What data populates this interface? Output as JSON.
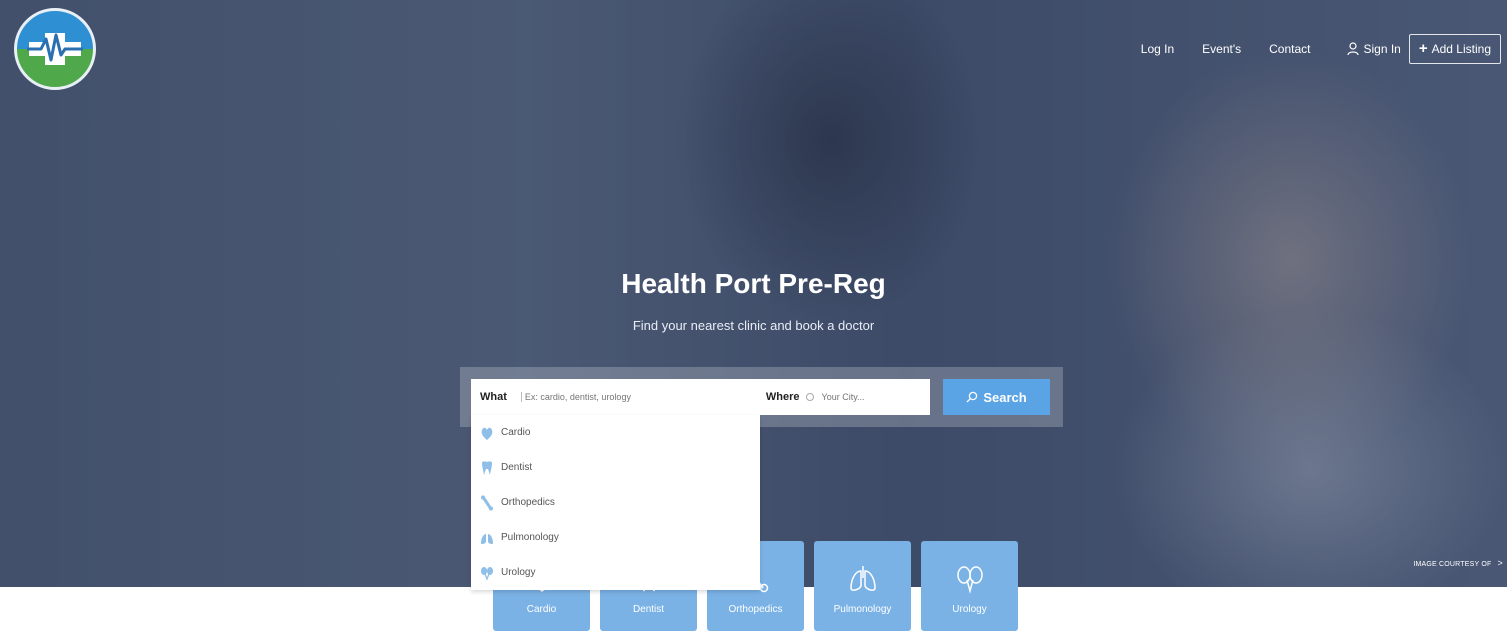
{
  "nav": {
    "login": "Log In",
    "events": "Event's",
    "contact": "Contact",
    "signin": "Sign In",
    "add_listing": "Add Listing"
  },
  "hero": {
    "title": "Health Port Pre-Reg",
    "subtitle": "Find your nearest clinic and book a doctor"
  },
  "search": {
    "what_label": "What",
    "what_placeholder": "Ex: cardio, dentist, urology",
    "where_label": "Where",
    "where_placeholder": "Your City...",
    "button_label": "Search"
  },
  "dropdown": {
    "items": [
      {
        "label": "Cardio",
        "icon": "heart-icon"
      },
      {
        "label": "Dentist",
        "icon": "tooth-icon"
      },
      {
        "label": "Orthopedics",
        "icon": "bone-icon"
      },
      {
        "label": "Pulmonology",
        "icon": "lungs-icon"
      },
      {
        "label": "Urology",
        "icon": "kidney-icon"
      }
    ]
  },
  "categories": [
    {
      "label": "Cardio",
      "icon": "heart-icon"
    },
    {
      "label": "Dentist",
      "icon": "tooth-icon"
    },
    {
      "label": "Orthopedics",
      "icon": "bone-icon"
    },
    {
      "label": "Pulmonology",
      "icon": "lungs-icon"
    },
    {
      "label": "Urology",
      "icon": "kidney-icon"
    }
  ],
  "image_courtesy": "IMAGE COURTESY OF",
  "colors": {
    "accent": "#5aa3e5",
    "category_tile": "#7ab2e6",
    "overlay": "#1c2c4e"
  }
}
